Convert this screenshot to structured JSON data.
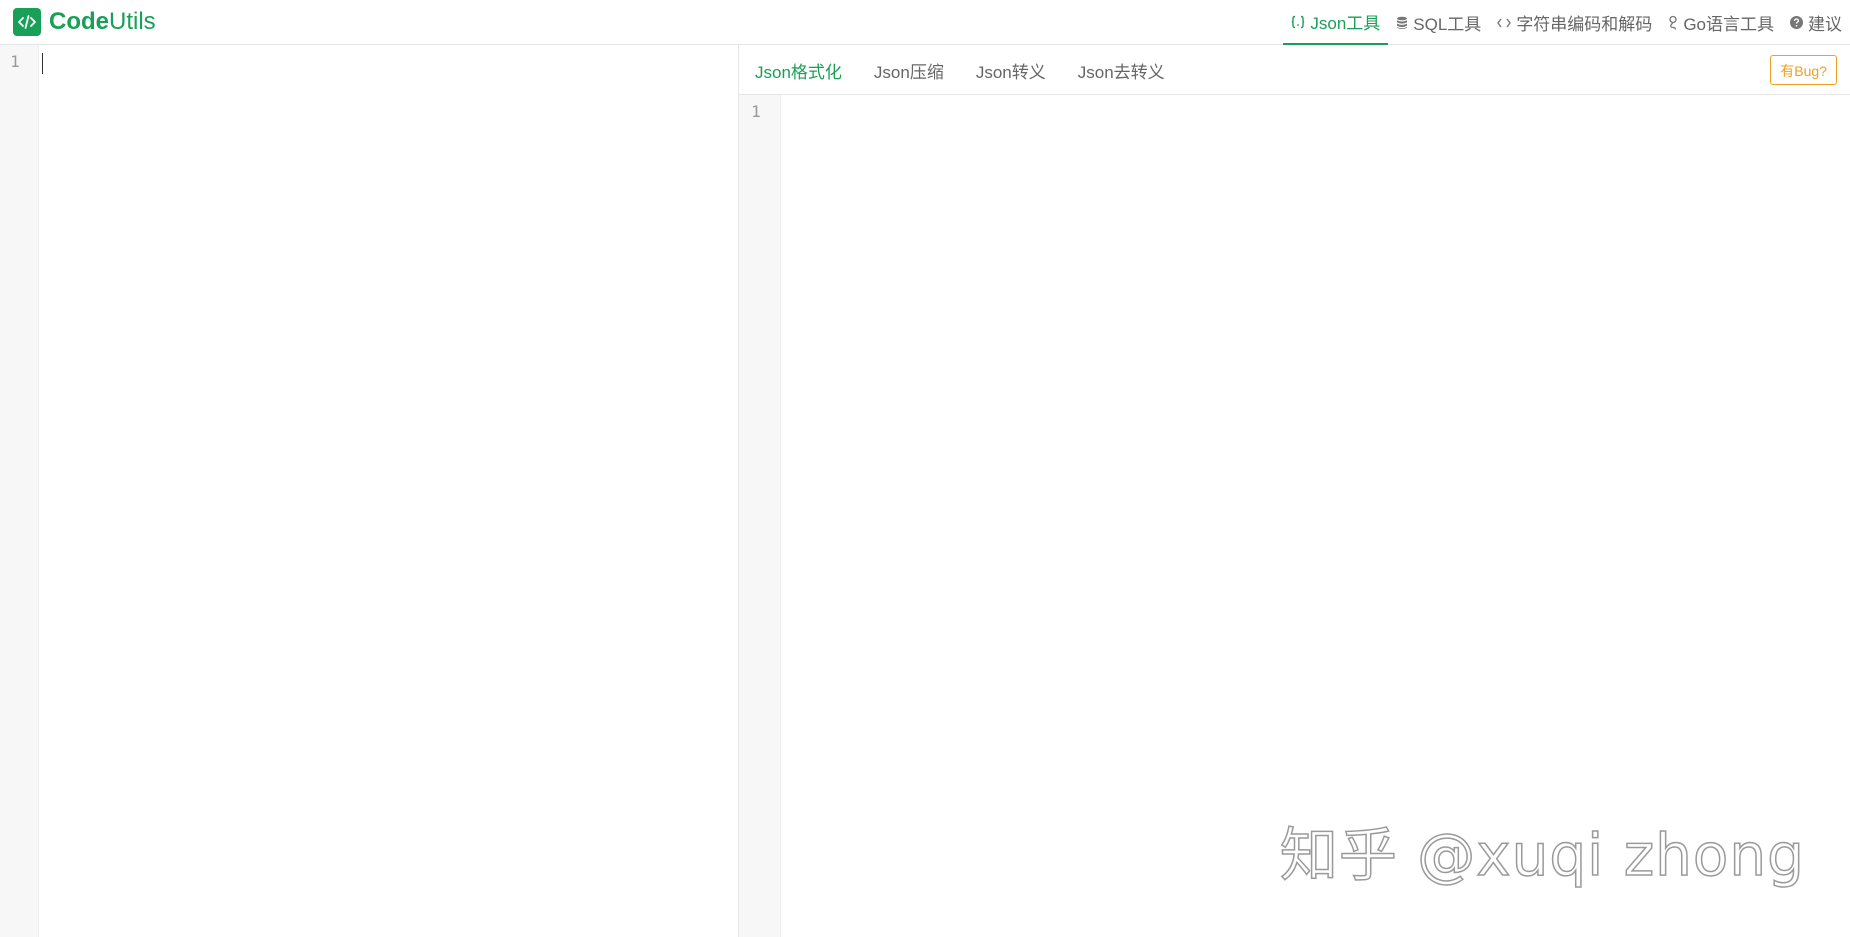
{
  "brand": {
    "name_bold": "Code",
    "name_rest": "Utils",
    "logo_icon": "code-slash-icon",
    "color": "#18a058"
  },
  "nav": {
    "items": [
      {
        "label": "Json工具",
        "icon": "braces-icon",
        "active": true
      },
      {
        "label": "SQL工具",
        "icon": "database-icon",
        "active": false
      },
      {
        "label": "字符串编码和解码",
        "icon": "code-icon",
        "active": false
      },
      {
        "label": "Go语言工具",
        "icon": "golang-icon",
        "active": false
      },
      {
        "label": "建议",
        "icon": "question-circle-icon",
        "active": false
      }
    ]
  },
  "left_editor": {
    "line_numbers": [
      "1"
    ],
    "content": ""
  },
  "right_panel": {
    "tabs": [
      {
        "label": "Json格式化",
        "active": true
      },
      {
        "label": "Json压缩",
        "active": false
      },
      {
        "label": "Json转义",
        "active": false
      },
      {
        "label": "Json去转义",
        "active": false
      }
    ],
    "bug_button_label": "有Bug?",
    "line_numbers": [
      "1"
    ],
    "content": ""
  },
  "watermark": {
    "text": "知乎 @xuqi zhong"
  },
  "colors": {
    "accent": "#18a058",
    "warning": "#f0a020",
    "gutter_bg": "#f7f7f7",
    "muted_text": "#666666"
  }
}
